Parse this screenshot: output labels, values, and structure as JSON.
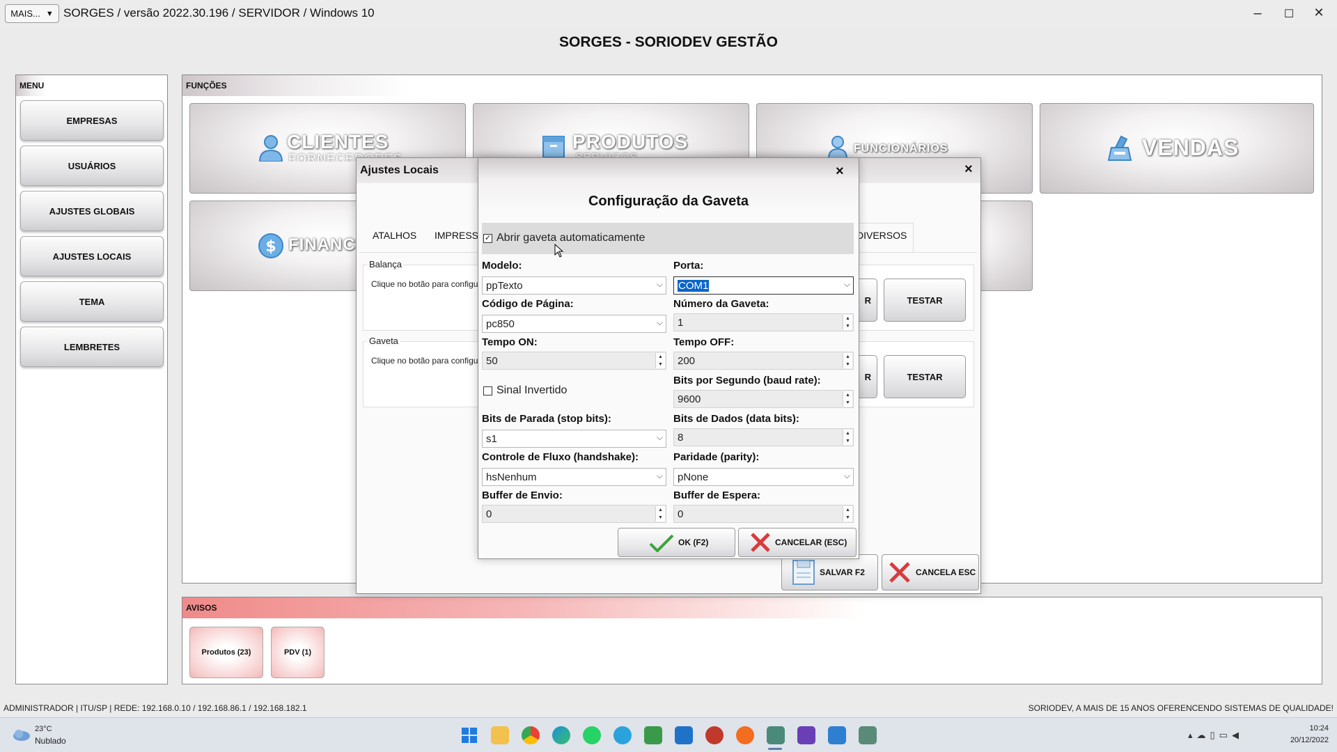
{
  "window": {
    "mais_label": "MAIS...",
    "mais_arrow": "▼",
    "title": "SORGES / versão 2022.30.196 / SERVIDOR / Windows 10",
    "minimize": "–",
    "maximize": "☐",
    "close": "✕",
    "app_header": "SORGES - SORIODEV GESTÃO"
  },
  "menu": {
    "title": "MENU",
    "items": [
      {
        "label": "EMPRESAS"
      },
      {
        "label": "USUÁRIOS"
      },
      {
        "label": "AJUSTES GLOBAIS"
      },
      {
        "label": "AJUSTES LOCAIS"
      },
      {
        "label": "TEMA"
      },
      {
        "label": "LEMBRETES"
      }
    ]
  },
  "funcoes": {
    "title": "FUNÇÕES",
    "clientes": "CLIENTES",
    "clientes_sub": "FORNECEDORES",
    "produtos": "PRODUTOS",
    "produtos_sub": "SERVIÇOS",
    "funcionarios": "FUNCIONÁRIOS",
    "vendas": "VENDAS",
    "financeiro": "FINANCEIRO"
  },
  "avisos": {
    "title": "AVISOS",
    "items": [
      {
        "label": "Produtos (23)"
      },
      {
        "label": "PDV (1)"
      }
    ]
  },
  "ajustes_locais": {
    "title": "Ajustes Locais",
    "close": "×",
    "tabs": [
      "ATALHOS",
      "IMPRESS...",
      "DIVERSOS"
    ],
    "balanca_title": "Balança",
    "balanca_text": "Clique no botão para configurar",
    "gaveta_title": "Gaveta",
    "gaveta_text": "Clique no botão para configurar",
    "config_partial": "R",
    "testar": "TESTAR",
    "salvar": "SALVAR F2",
    "cancela": "CANCELA ESC"
  },
  "gaveta": {
    "title": "Configuração da Gaveta",
    "close": "×",
    "abrir_auto": {
      "label": "Abrir gaveta automaticamente",
      "checked": true
    },
    "modelo": {
      "label": "Modelo:",
      "value": "ppTexto"
    },
    "porta": {
      "label": "Porta:",
      "value": "COM1"
    },
    "codigo_pagina": {
      "label": "Código de Página:",
      "value": "pc850"
    },
    "numero_gaveta": {
      "label": "Número da Gaveta:",
      "value": "1"
    },
    "tempo_on": {
      "label": "Tempo ON:",
      "value": "50"
    },
    "tempo_off": {
      "label": "Tempo OFF:",
      "value": "200"
    },
    "sinal_invertido": {
      "label": "Sinal Invertido",
      "checked": false
    },
    "baud_rate": {
      "label": "Bits por Segundo (baud rate):",
      "value": "9600"
    },
    "stop_bits": {
      "label": "Bits de Parada (stop bits):",
      "value": "s1"
    },
    "data_bits": {
      "label": "Bits de Dados (data bits):",
      "value": "8"
    },
    "handshake": {
      "label": "Controle de Fluxo (handshake):",
      "value": "hsNenhum"
    },
    "parity": {
      "label": "Paridade (parity):",
      "value": "pNone"
    },
    "buffer_envio": {
      "label": "Buffer de Envio:",
      "value": "0"
    },
    "buffer_espera": {
      "label": "Buffer de Espera:",
      "value": "0"
    },
    "ok": "OK (F2)",
    "cancelar": "CANCELAR (ESC)"
  },
  "status": {
    "left": "ADMINISTRADOR |   ITU/SP |   REDE: 192.168.0.10 / 192.168.86.1 / 192.168.182.1",
    "right": "SORIODEV, A MAIS DE 15 ANOS OFERENCENDO SISTEMAS DE QUALIDADE!"
  },
  "taskbar": {
    "weather_temp": "23°C",
    "weather_desc": "Nublado",
    "time": "10:24",
    "date": "20/12/2022"
  },
  "colors": {
    "accent_red": "#f08a8a",
    "selection_blue": "#0a64c8",
    "check_green": "#3aa33a",
    "cancel_red": "#d83b3b"
  }
}
